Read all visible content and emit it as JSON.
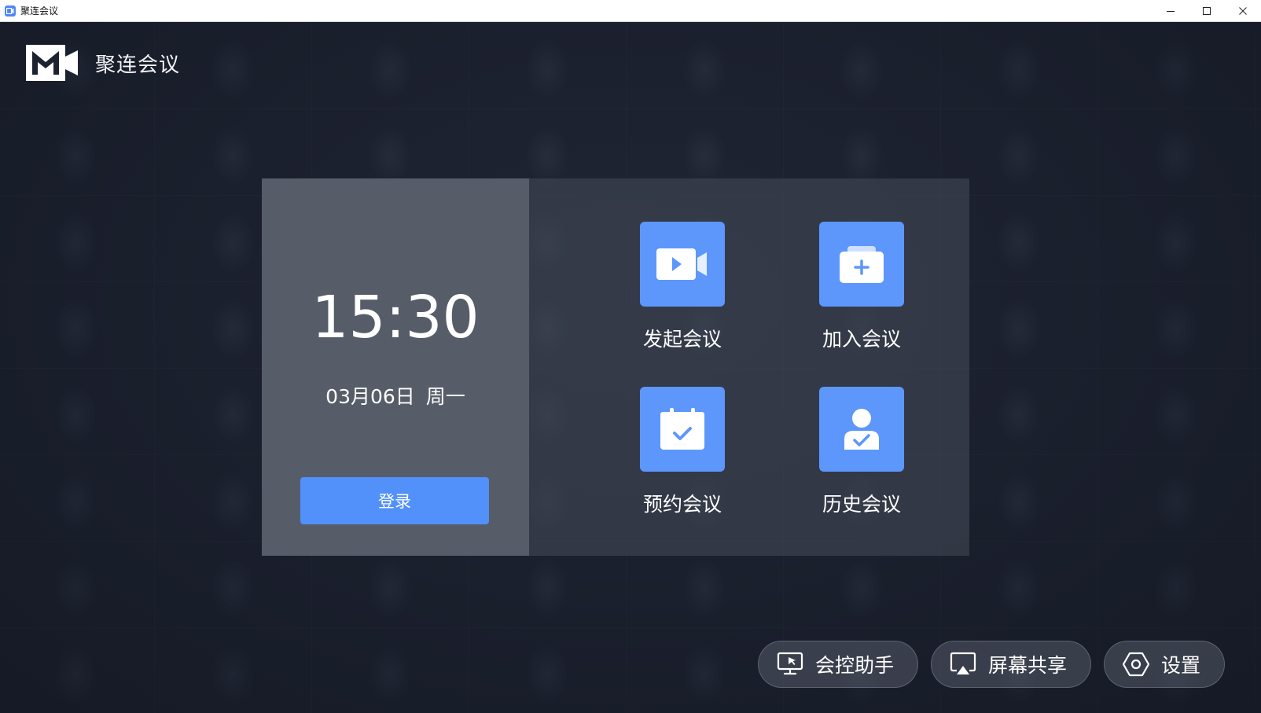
{
  "window": {
    "title": "聚连会议"
  },
  "brand": {
    "name": "聚连会议",
    "logo_icon": "brand-camera-m-icon"
  },
  "clock": {
    "time": "15:30",
    "date": "03月06日",
    "weekday": "周一"
  },
  "login": {
    "label": "登录"
  },
  "tiles": [
    {
      "label": "发起会议",
      "icon": "video-camera-icon"
    },
    {
      "label": "加入会议",
      "icon": "folder-plus-icon"
    },
    {
      "label": "预约会议",
      "icon": "calendar-check-icon"
    },
    {
      "label": "历史会议",
      "icon": "user-check-icon"
    }
  ],
  "bottom": [
    {
      "label": "会控助手",
      "icon": "meeting-control-icon"
    },
    {
      "label": "屏幕共享",
      "icon": "screen-share-icon"
    },
    {
      "label": "设置",
      "icon": "settings-hexagon-icon"
    }
  ],
  "colors": {
    "accent": "#5290fa",
    "tile": "#5d97fb",
    "panel_left": "#575d68",
    "background": "#1c2130"
  }
}
